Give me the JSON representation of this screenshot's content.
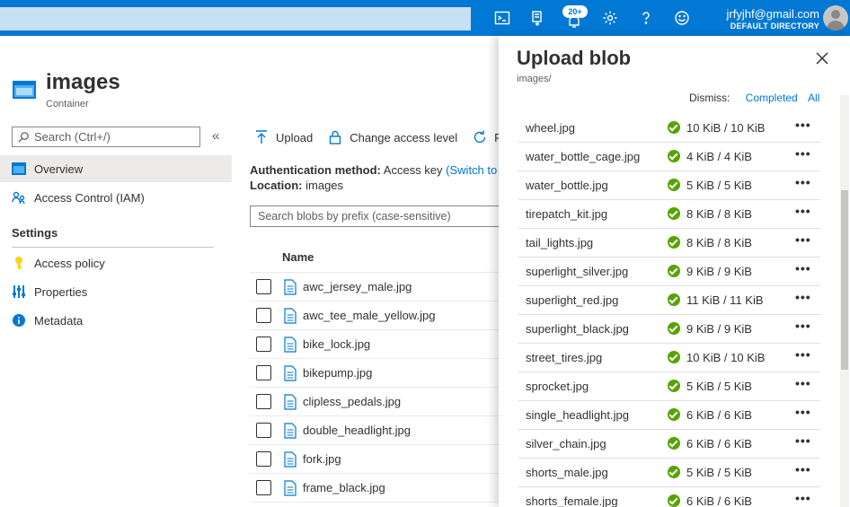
{
  "topbar": {
    "notification_count": "20+",
    "email": "jrfyjhf@gmail.com",
    "directory": "DEFAULT DIRECTORY"
  },
  "header": {
    "title": "images",
    "subtitle": "Container"
  },
  "nav": {
    "search_placeholder": "Search (Ctrl+/)",
    "collapse": "«",
    "items": [
      {
        "label": "Overview",
        "icon": "overview-icon"
      },
      {
        "label": "Access Control (IAM)",
        "icon": "people-icon"
      }
    ],
    "settings_heading": "Settings",
    "settings_items": [
      {
        "label": "Access policy",
        "icon": "key-icon"
      },
      {
        "label": "Properties",
        "icon": "properties-icon"
      },
      {
        "label": "Metadata",
        "icon": "info-icon"
      }
    ]
  },
  "toolbar": {
    "upload": "Upload",
    "change_access": "Change access level",
    "refresh": "Re"
  },
  "main": {
    "auth_label": "Authentication method:",
    "auth_value": "Access key",
    "auth_link": "(Switch to",
    "location_label": "Location:",
    "location_value": "images",
    "search_placeholder": "Search blobs by prefix (case-sensitive)",
    "column_name": "Name",
    "files": [
      "awc_jersey_male.jpg",
      "awc_tee_male_yellow.jpg",
      "bike_lock.jpg",
      "bikepump.jpg",
      "clipless_pedals.jpg",
      "double_headlight.jpg",
      "fork.jpg",
      "frame_black.jpg"
    ]
  },
  "panel": {
    "title": "Upload blob",
    "path": "images/",
    "dismiss_label": "Dismiss:",
    "dismiss_completed": "Completed",
    "dismiss_all": "All",
    "more": "•••",
    "uploads": [
      {
        "name": "wheel.jpg",
        "size": "10 KiB / 10 KiB"
      },
      {
        "name": "water_bottle_cage.jpg",
        "size": "4 KiB / 4 KiB"
      },
      {
        "name": "water_bottle.jpg",
        "size": "5 KiB / 5 KiB"
      },
      {
        "name": "tirepatch_kit.jpg",
        "size": "8 KiB / 8 KiB"
      },
      {
        "name": "tail_lights.jpg",
        "size": "8 KiB / 8 KiB"
      },
      {
        "name": "superlight_silver.jpg",
        "size": "9 KiB / 9 KiB"
      },
      {
        "name": "superlight_red.jpg",
        "size": "11 KiB / 11 KiB"
      },
      {
        "name": "superlight_black.jpg",
        "size": "9 KiB / 9 KiB"
      },
      {
        "name": "street_tires.jpg",
        "size": "10 KiB / 10 KiB"
      },
      {
        "name": "sprocket.jpg",
        "size": "5 KiB / 5 KiB"
      },
      {
        "name": "single_headlight.jpg",
        "size": "6 KiB / 6 KiB"
      },
      {
        "name": "silver_chain.jpg",
        "size": "6 KiB / 6 KiB"
      },
      {
        "name": "shorts_male.jpg",
        "size": "5 KiB / 5 KiB"
      },
      {
        "name": "shorts_female.jpg",
        "size": "6 KiB / 6 KiB"
      }
    ]
  },
  "colors": {
    "accent": "#0078d4",
    "success": "#57a300"
  }
}
